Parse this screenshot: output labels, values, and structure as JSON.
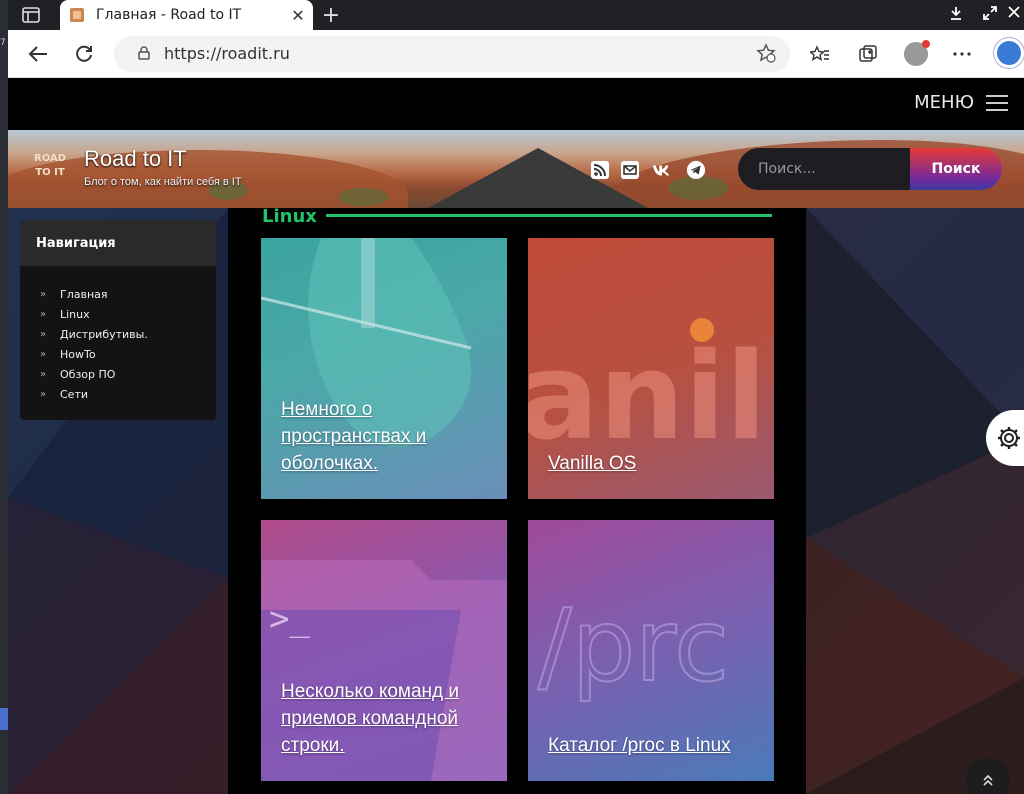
{
  "desktop": {
    "edge_label": "7"
  },
  "browser": {
    "tab_title": "Главная - Road to IT",
    "tab_close": "✕",
    "new_tab": "+",
    "url": "https://roadit.ru"
  },
  "site": {
    "menu_label": "МЕНЮ",
    "logo_text_line1": "ROAD",
    "logo_text_line2": "TO IT",
    "title": "Road to IT",
    "subtitle": "Блог о том, как найти себя в IT",
    "search_placeholder": "Поиск...",
    "search_button": "Поиск",
    "social": [
      "rss-icon",
      "mail-icon",
      "vk-icon",
      "telegram-icon"
    ]
  },
  "sidebar": {
    "header": "Навигация",
    "items": [
      {
        "label": "Главная"
      },
      {
        "label": "Linux"
      },
      {
        "label": "Дистрибутивы."
      },
      {
        "label": "HowTo"
      },
      {
        "label": "Обзор ПО"
      },
      {
        "label": "Сети"
      }
    ]
  },
  "main": {
    "section_title": "Linux",
    "cards": [
      {
        "title": "Немного о пространствах и оболочках."
      },
      {
        "title": "Vanilla OS"
      },
      {
        "title": "Несколько команд и приемов командной строки."
      },
      {
        "title": "Каталог /proc в Linux"
      }
    ]
  },
  "colors": {
    "accent_green": "#21c46a",
    "search_gradient_top": "#e53935",
    "page_bg": "#000000"
  }
}
